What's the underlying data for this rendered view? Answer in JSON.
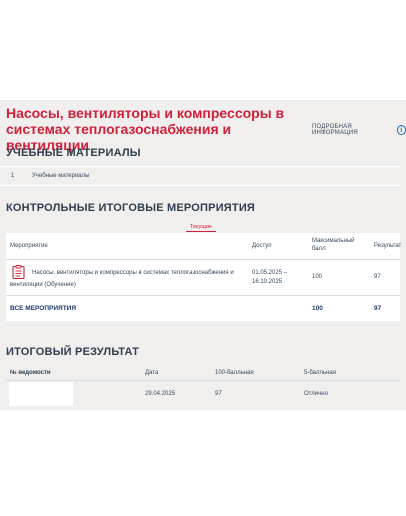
{
  "course": {
    "title": "Насосы, вентиляторы и компрессоры в системах теплогазоснабжения и вентиляции",
    "more_info": "ПОДРОБНАЯ ИНФОРМАЦИЯ",
    "info_glyph": "i"
  },
  "materials": {
    "title": "УЧЕБНЫЕ МАТЕРИАЛЫ",
    "items": [
      {
        "num": "1",
        "label": "Учебные материалы"
      }
    ]
  },
  "events": {
    "title": "КОНТРОЛЬНЫЕ ИТОГОВЫЕ МЕРОПРИЯТИЯ",
    "tab": "Текущие",
    "columns": {
      "event": "Мероприятие",
      "access": "Доступ",
      "max": "Максимальный балл",
      "result": "Результат"
    },
    "rows": [
      {
        "name": "Насосы, вентиляторы и компрессоры в системах теплогазоснабжения и вентиляции (Обучение)",
        "access": "01.05.2025 – 16.10.2025",
        "max": "100",
        "result": "97",
        "icon": "document-list-icon"
      }
    ],
    "total": {
      "label": "ВСЕ МЕРОПРИЯТИЯ",
      "max": "100",
      "result": "97"
    }
  },
  "final": {
    "title": "ИТОГОВЫЙ РЕЗУЛЬТАТ",
    "columns": {
      "statement": "№ ведомости",
      "date": "Дата",
      "score100": "100-балльная",
      "score5": "5-балльная"
    },
    "rows": [
      {
        "statement": "",
        "date": "29.04.2025",
        "score100": "97",
        "score5": "Отлично"
      }
    ]
  },
  "colors": {
    "accent_red": "#d0203a",
    "heading": "#2c3e50",
    "link_blue": "#2a6fb5",
    "panel_bg": "#f0efee"
  }
}
